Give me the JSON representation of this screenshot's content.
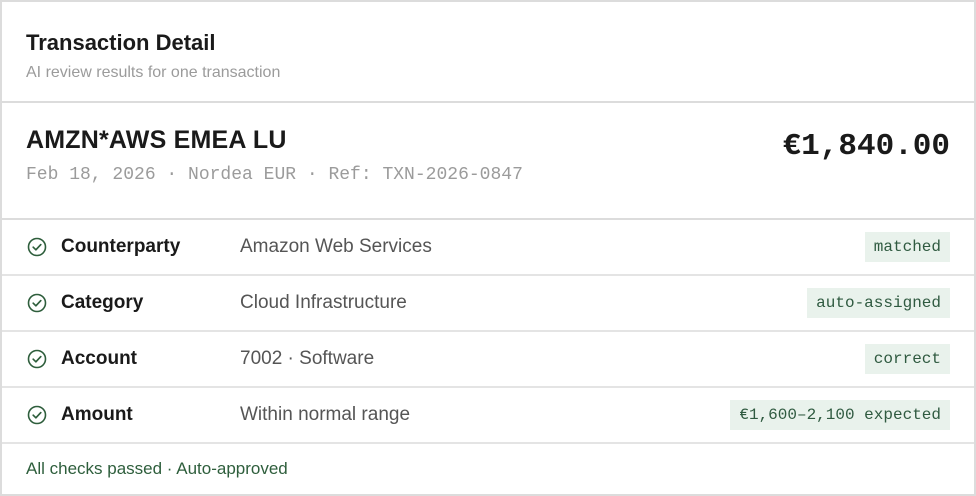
{
  "header": {
    "title": "Transaction Detail",
    "subtitle": "AI review results for one transaction"
  },
  "transaction": {
    "merchant": "AMZN*AWS EMEA LU",
    "meta": "Feb 18, 2026 · Nordea EUR · Ref: TXN-2026-0847",
    "amount": "€1,840.00"
  },
  "checks": [
    {
      "label": "Counterparty",
      "value": "Amazon Web Services",
      "badge": "matched",
      "icon": "check-circle-icon"
    },
    {
      "label": "Category",
      "value": "Cloud Infrastructure",
      "badge": "auto-assigned",
      "icon": "check-circle-icon"
    },
    {
      "label": "Account",
      "value": "7002 · Software",
      "badge": "correct",
      "icon": "check-circle-icon"
    },
    {
      "label": "Amount",
      "value": "Within normal range",
      "badge": "€1,600–2,100 expected",
      "icon": "check-circle-icon"
    }
  ],
  "footer": {
    "status": "All checks passed · Auto-approved"
  },
  "colors": {
    "accent_green": "#2e5e3c",
    "badge_bg": "#e9f2ec",
    "border": "#dcdcdc",
    "muted_text": "#9b9b9b"
  }
}
